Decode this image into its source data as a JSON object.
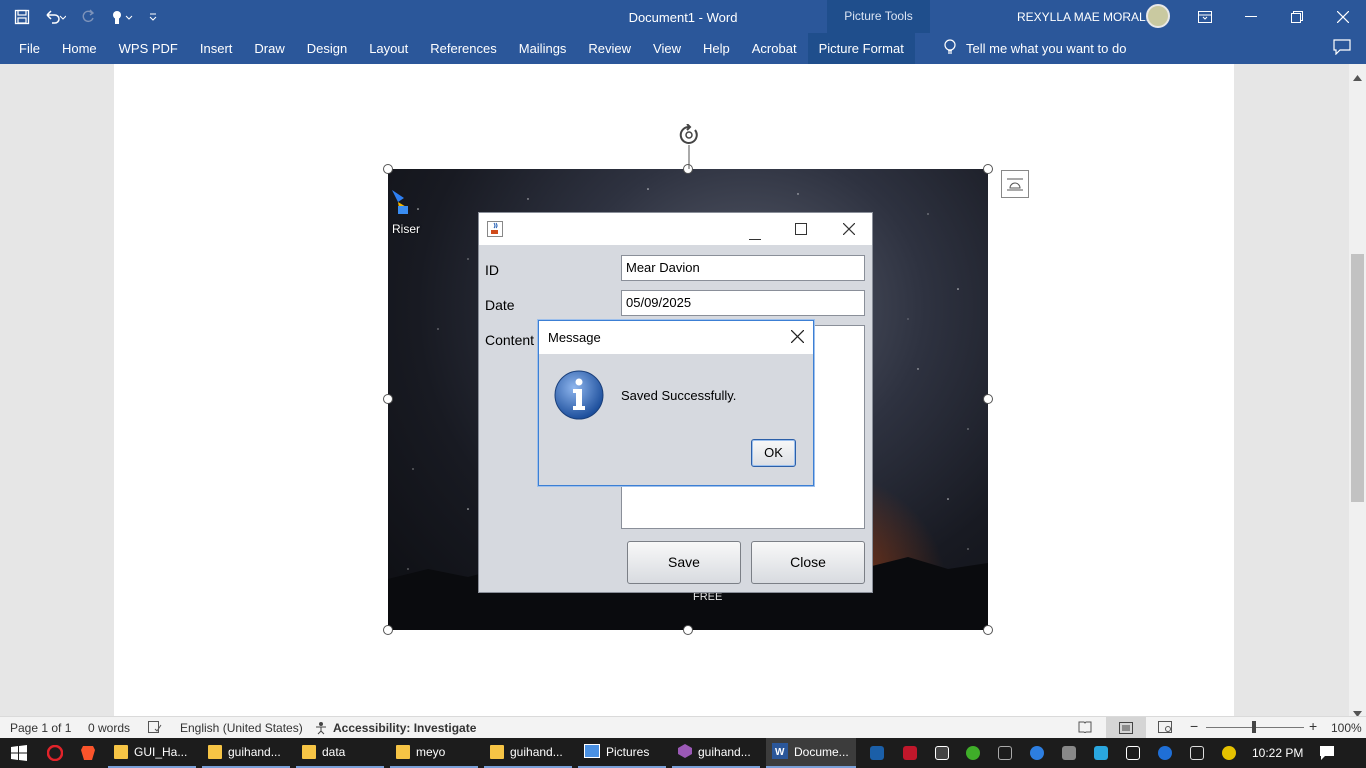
{
  "window": {
    "title": "Document1  -  Word",
    "context_tab_group": "Picture Tools",
    "user_name": "REXYLLA MAE MORALES"
  },
  "qat": {
    "icons": [
      "save-icon",
      "undo-icon",
      "redo-icon",
      "touch-mode-icon",
      "customize-qat-icon"
    ]
  },
  "ribbon": {
    "tabs": [
      {
        "label": "File"
      },
      {
        "label": "Home"
      },
      {
        "label": "WPS PDF"
      },
      {
        "label": "Insert"
      },
      {
        "label": "Draw"
      },
      {
        "label": "Design"
      },
      {
        "label": "Layout"
      },
      {
        "label": "References"
      },
      {
        "label": "Mailings"
      },
      {
        "label": "Review"
      },
      {
        "label": "View"
      },
      {
        "label": "Help"
      },
      {
        "label": "Acrobat"
      },
      {
        "label": "Picture Format"
      }
    ],
    "active_tab": "Picture Format",
    "tell_me": "Tell me what you want to do"
  },
  "picture": {
    "desktop_icon_label": "Riser",
    "bottom_label": "FREE"
  },
  "java_window": {
    "fields": [
      {
        "label": "ID",
        "value": "Mear Davion"
      },
      {
        "label": "Date",
        "value": "05/09/2025"
      },
      {
        "label": "Content",
        "value": ""
      }
    ],
    "save_button": "Save",
    "close_button": "Close"
  },
  "message_dialog": {
    "title": "Message",
    "text": "Saved Successfully.",
    "ok_button": "OK",
    "icon": "info-icon"
  },
  "statusbar": {
    "page": "Page 1 of 1",
    "words": "0 words",
    "language": "English (United States)",
    "accessibility": "Accessibility: Investigate",
    "zoom": "100%",
    "zoom_level": 1.0
  },
  "taskbar": {
    "items": [
      {
        "label": "GUI_Ha...",
        "icon": "folder-icon"
      },
      {
        "label": "guihand...",
        "icon": "folder-icon"
      },
      {
        "label": "data",
        "icon": "folder-icon"
      },
      {
        "label": "meyo",
        "icon": "folder-icon"
      },
      {
        "label": "guihand...",
        "icon": "folder-icon"
      },
      {
        "label": "Pictures",
        "icon": "pictures-icon"
      },
      {
        "label": "guihand...",
        "icon": "app-icon"
      },
      {
        "label": "Docume...",
        "icon": "word-icon"
      }
    ],
    "time": "10:22 PM"
  },
  "colors": {
    "ribbon_blue": "#2b579a",
    "context_tab": "#1f4e8c",
    "dialog_border": "#3c7fd4"
  }
}
